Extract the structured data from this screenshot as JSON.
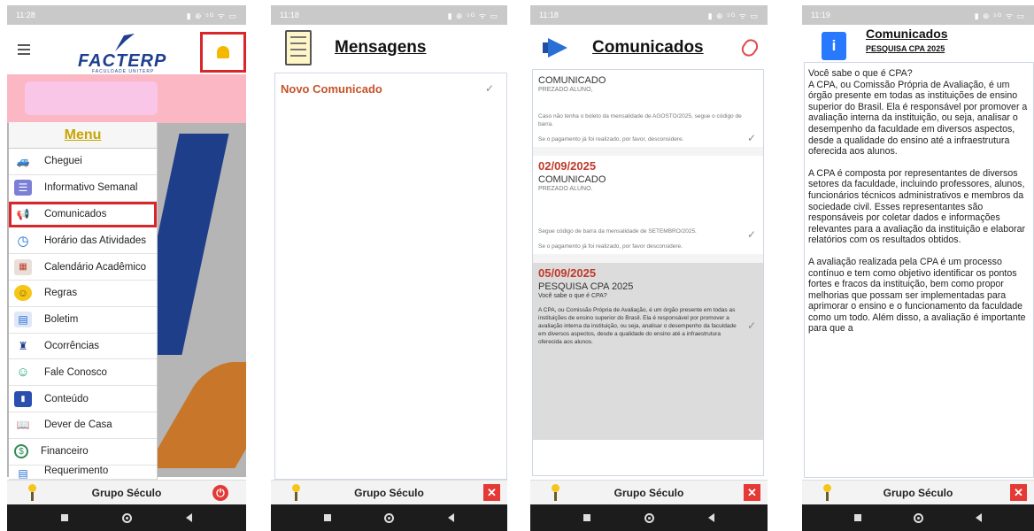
{
  "phones": [
    {
      "status": {
        "time": "11:28",
        "icons": "▮ ⊕ ⁵ᴳ ᯤ ▭"
      },
      "header": {
        "logo_text": "FACTERP",
        "logo_sub": "FACULDADE UNITERP"
      },
      "menu": {
        "title": "Menu",
        "items": [
          {
            "label": "Cheguei",
            "icon": "car-icon"
          },
          {
            "label": "Informativo Semanal",
            "icon": "newsletter-icon"
          },
          {
            "label": "Comunicados",
            "icon": "megaphone-icon"
          },
          {
            "label": "Horário das Atividades",
            "icon": "clock-icon"
          },
          {
            "label": "Calendário Acadêmico",
            "icon": "calendar-icon"
          },
          {
            "label": "Regras",
            "icon": "smiley-icon"
          },
          {
            "label": "Boletim",
            "icon": "report-icon"
          },
          {
            "label": "Ocorrências",
            "icon": "officer-icon"
          },
          {
            "label": "Fale Conosco",
            "icon": "chat-icon"
          },
          {
            "label": "Conteúdo",
            "icon": "book-icon"
          },
          {
            "label": "Dever de Casa",
            "icon": "homework-icon"
          },
          {
            "label": "Financeiro",
            "icon": "dollar-icon"
          },
          {
            "label": "Requerimento",
            "icon": "form-icon"
          }
        ]
      },
      "footer": {
        "label": "Grupo Século"
      }
    },
    {
      "status": {
        "time": "11:18",
        "icons": "▮ ⊕ ⁵ᴳ ᯤ ▭"
      },
      "title": "Mensagens",
      "rows": [
        {
          "label": "Novo Comunicado"
        }
      ],
      "footer": {
        "label": "Grupo Século",
        "close": "✕"
      }
    },
    {
      "status": {
        "time": "11:18",
        "icons": "▮ ⊕ ⁵ᴳ ᯤ ▭"
      },
      "title": "Comunicados",
      "messages": [
        {
          "date": "",
          "title": "COMUNICADO",
          "sub": "PREZADO ALUNO,",
          "body1": "Caso não tenha o boleto da mensalidade de AGOSTO/2025, segue o código de barra.",
          "body2": "Se o pagamento já foi realizado, por favor, desconsidere."
        },
        {
          "date": "02/09/2025",
          "title": "COMUNICADO",
          "sub": "PREZADO ALUNO.",
          "body1": "Segue código de barra da mensalidade de SETEMBRO/2025.",
          "body2": "Se o pagamento já foi realizado, por favor desconsidere."
        },
        {
          "date": "05/09/2025",
          "title": "PESQUISA CPA 2025",
          "sub": "Você sabe o que é CPA?",
          "body1": "A CPA, ou Comissão Própria de Avaliação, é um órgão presente em todas as instituições de ensino superior do Brasil. Ela é responsável por promover a avaliação interna da instituição, ou seja, analisar o desempenho da faculdade em diversos aspectos, desde a qualidade do ensino até a infraestrutura oferecida aos alunos.",
          "body2": ""
        }
      ],
      "footer": {
        "label": "Grupo Século",
        "close": "✕"
      }
    },
    {
      "status": {
        "time": "11:19",
        "icons": "▮ ⊕ ⁵ᴳ ᯤ ▭"
      },
      "title": "Comunicados",
      "subtitle": "PESQUISA CPA 2025",
      "paragraphs": [
        "Você sabe o que é CPA?\nA CPA, ou Comissão Própria de Avaliação, é um órgão presente em todas as instituições de ensino superior do Brasil. Ela é responsável por promover a avaliação interna da instituição, ou seja, analisar o desempenho da faculdade em diversos aspectos, desde a qualidade do ensino até a infraestrutura oferecida aos alunos.",
        "A CPA é composta por representantes de diversos setores da faculdade, incluindo professores, alunos, funcionários técnicos administrativos e membros da sociedade civil. Esses representantes são responsáveis por coletar dados e informações relevantes para a avaliação da instituição e elaborar relatórios com os resultados obtidos.",
        "A avaliação realizada pela CPA é um processo contínuo e tem como objetivo identificar os pontos fortes e fracos da instituição, bem como propor melhorias que possam ser implementadas para aprimorar o ensino e o funcionamento da faculdade como um todo. Além disso, a avaliação é importante para que a"
      ],
      "footer": {
        "label": "Grupo Século",
        "close": "✕"
      }
    }
  ],
  "colors": {
    "accent_red": "#d9262b",
    "brand_blue": "#1e3f8f",
    "menu_title": "#c8a500",
    "date_red": "#c0392b"
  }
}
